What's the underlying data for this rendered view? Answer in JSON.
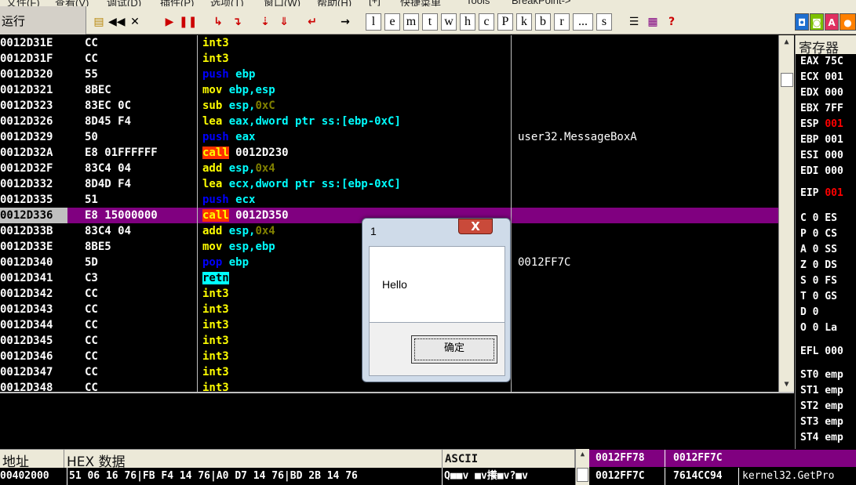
{
  "menubar": {
    "items": [
      "文件(F)",
      "查看(V)",
      "调试(D)",
      "插件(P)",
      "选项(T)",
      "窗口(W)",
      "帮助(H)",
      "[+]",
      "快捷菜单",
      "Tools",
      "BreakPoint->"
    ]
  },
  "toolbar": {
    "status": "运行",
    "letters": [
      "l",
      "e",
      "m",
      "t",
      "w",
      "h",
      "c",
      "P",
      "k",
      "b",
      "r",
      "...",
      "s"
    ]
  },
  "disasm": [
    {
      "addr": "0012D31E",
      "hex": "CC",
      "mn": "int3",
      "op": "",
      "comment": ""
    },
    {
      "addr": "0012D31F",
      "hex": "CC",
      "mn": "int3",
      "op": "",
      "comment": ""
    },
    {
      "addr": "0012D320",
      "hex": "55",
      "mn": "push",
      "op": "ebp",
      "comment": ""
    },
    {
      "addr": "0012D321",
      "hex": "8BEC",
      "mn": "mov",
      "op": "ebp,esp",
      "comment": ""
    },
    {
      "addr": "0012D323",
      "hex": "83EC 0C",
      "mn": "sub",
      "op": "esp,",
      "imm": "0xC",
      "comment": ""
    },
    {
      "addr": "0012D326",
      "hex": "8D45 F4",
      "mn": "lea",
      "op": "eax,dword ptr ss:[ebp-0xC]",
      "comment": ""
    },
    {
      "addr": "0012D329",
      "hex": "50",
      "mn": "push",
      "op": "eax",
      "comment": "user32.MessageBoxA"
    },
    {
      "addr": "0012D32A",
      "hex": "E8 01FFFFFF",
      "mn": "call",
      "tgt": "0012D230",
      "comment": ""
    },
    {
      "addr": "0012D32F",
      "hex": "83C4 04",
      "mn": "add",
      "op": "esp,",
      "imm": "0x4",
      "comment": ""
    },
    {
      "addr": "0012D332",
      "hex": "8D4D F4",
      "mn": "lea",
      "op": "ecx,dword ptr ss:[ebp-0xC]",
      "comment": ""
    },
    {
      "addr": "0012D335",
      "hex": "51",
      "mn": "push",
      "op": "ecx",
      "comment": ""
    },
    {
      "addr": "0012D336",
      "hex": "E8 15000000",
      "mn": "call",
      "tgt": "0012D350",
      "comment": "",
      "sel": true
    },
    {
      "addr": "0012D33B",
      "hex": "83C4 04",
      "mn": "add",
      "op": "esp,",
      "imm": "0x4",
      "comment": ""
    },
    {
      "addr": "0012D33E",
      "hex": "8BE5",
      "mn": "mov",
      "op": "esp,ebp",
      "comment": ""
    },
    {
      "addr": "0012D340",
      "hex": "5D",
      "mn": "pop",
      "op": "ebp",
      "comment": "0012FF7C"
    },
    {
      "addr": "0012D341",
      "hex": "C3",
      "mn": "retn",
      "op": "",
      "comment": ""
    },
    {
      "addr": "0012D342",
      "hex": "CC",
      "mn": "int3",
      "op": "",
      "comment": ""
    },
    {
      "addr": "0012D343",
      "hex": "CC",
      "mn": "int3",
      "op": "",
      "comment": ""
    },
    {
      "addr": "0012D344",
      "hex": "CC",
      "mn": "int3",
      "op": "",
      "comment": ""
    },
    {
      "addr": "0012D345",
      "hex": "CC",
      "mn": "int3",
      "op": "",
      "comment": ""
    },
    {
      "addr": "0012D346",
      "hex": "CC",
      "mn": "int3",
      "op": "",
      "comment": ""
    },
    {
      "addr": "0012D347",
      "hex": "CC",
      "mn": "int3",
      "op": "",
      "comment": ""
    },
    {
      "addr": "0012D348",
      "hex": "CC",
      "mn": "int3",
      "op": "",
      "comment": ""
    }
  ],
  "registers": {
    "title": "寄存器",
    "items": [
      {
        "text": "EAX 75C"
      },
      {
        "text": "ECX 001"
      },
      {
        "text": "EDX 000"
      },
      {
        "text": "EBX 7FF"
      },
      {
        "text": "ESP ",
        "val": "001",
        "red": true
      },
      {
        "text": "EBP 001"
      },
      {
        "text": "ESI 000"
      },
      {
        "text": "EDI 000"
      },
      {
        "text": "EIP ",
        "val": "001",
        "red": true
      },
      {
        "text": "C 0  ES"
      },
      {
        "text": "P 0  CS"
      },
      {
        "text": "A 0  SS"
      },
      {
        "text": "Z 0  DS"
      },
      {
        "text": "S 0  FS"
      },
      {
        "text": "T 0  GS"
      },
      {
        "text": "D 0"
      },
      {
        "text": "O 0  La"
      },
      {
        "text": "EFL 000"
      },
      {
        "text": "ST0 emp"
      },
      {
        "text": "ST1 emp"
      },
      {
        "text": "ST2 emp"
      },
      {
        "text": "ST3 emp"
      },
      {
        "text": "ST4 emp"
      }
    ]
  },
  "dump": {
    "col_addr": "地址",
    "col_hex": "HEX 数据",
    "col_ascii": "ASCII",
    "row": {
      "addr": "00402000",
      "hex": "51 06 16 76|FB F4 14 76|A0 D7 14 76|BD 2B 14 76",
      "ascii": "Q■■v  ■v攁■v?■v"
    }
  },
  "stack": [
    {
      "addr": "0012FF78",
      "val": "0012FF7C",
      "comment": "",
      "sel": true
    },
    {
      "addr": "0012FF7C",
      "val": "7614CC94",
      "comment": "kernel32.GetPro"
    }
  ],
  "msgbox": {
    "title": "1",
    "text": "Hello",
    "ok": "确定",
    "close": "X"
  }
}
